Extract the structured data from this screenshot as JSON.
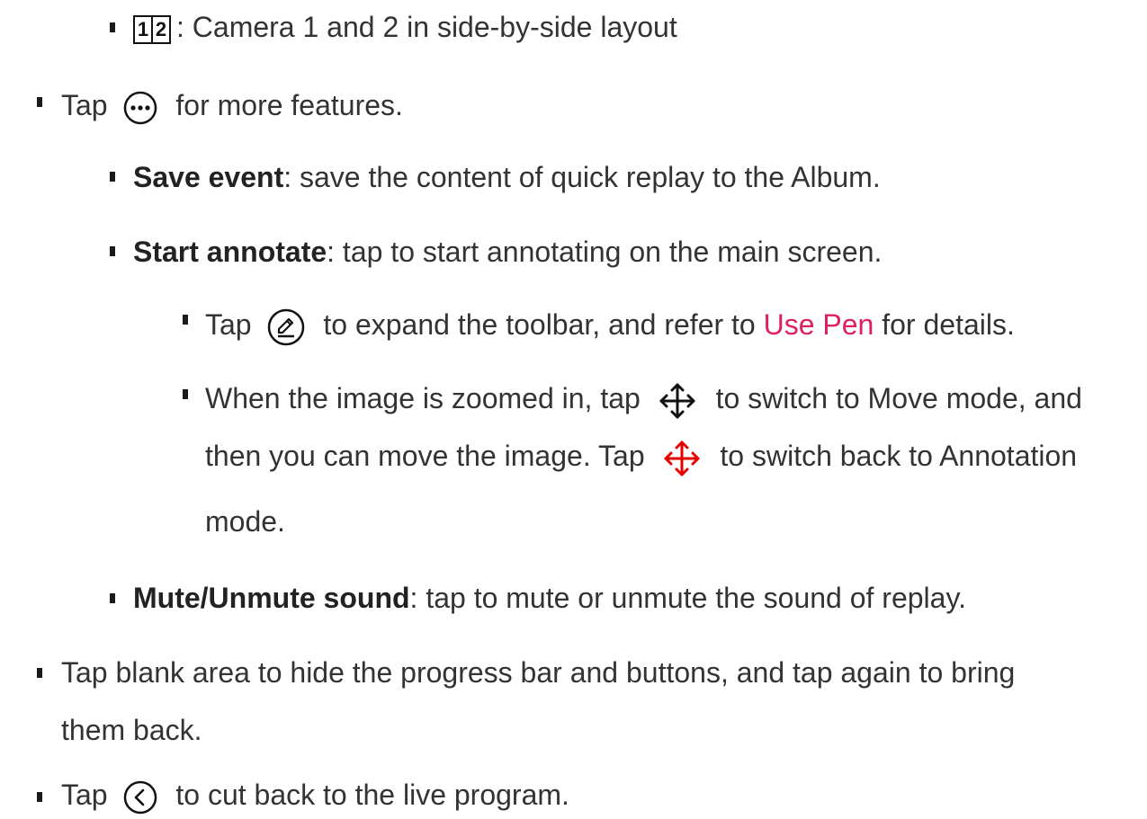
{
  "colors": {
    "link": "#e0205e",
    "text": "#333333",
    "move_back_icon": "#e60000"
  },
  "icons": {
    "more": "more-options-icon",
    "pen": "pen-icon",
    "move": "move-arrows-icon",
    "move_back": "move-arrows-red-icon",
    "back": "back-chevron-icon",
    "layout": "camera-layout-1-2-icon"
  },
  "items": {
    "layout": {
      "digit1": "1",
      "digit2": "2",
      "text": ": Camera 1 and 2 in side-by-side layout"
    },
    "more": {
      "pre": "Tap",
      "post": "for more features."
    },
    "save": {
      "label": "Save event",
      "text": ": save the content of quick replay to the Album."
    },
    "annotate": {
      "label": "Start annotate",
      "text": ": tap to start annotating on the main screen."
    },
    "pen": {
      "pre": "Tap",
      "mid": "to expand the toolbar, and refer to",
      "link": "Use Pen",
      "post": "for details."
    },
    "move": {
      "line1_pre": "When the image is zoomed in, tap",
      "line1_post": "to switch to Move mode, and",
      "line2_pre": "then you can move the image. Tap",
      "line2_post": "to switch back to Annotation",
      "line3": "mode."
    },
    "mute": {
      "label": "Mute/Unmute sound",
      "text": ": tap to mute or unmute the sound of replay."
    },
    "blank": {
      "line1": "Tap blank area to hide the progress bar and buttons, and tap again to bring",
      "line2": "them back."
    },
    "back": {
      "pre": "Tap",
      "post": "to cut back to the live program."
    }
  }
}
